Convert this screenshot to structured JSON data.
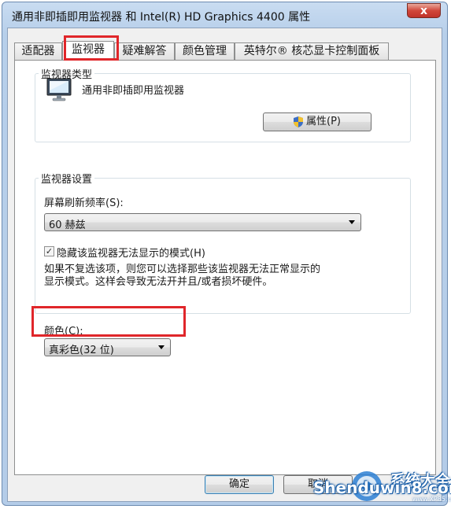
{
  "window": {
    "title": "通用非即插即用监视器 和 Intel(R) HD Graphics 4400 属性",
    "close_label": "x"
  },
  "tabs": [
    {
      "label": "适配器"
    },
    {
      "label": "监视器"
    },
    {
      "label": "疑难解答"
    },
    {
      "label": "颜色管理"
    },
    {
      "label": "英特尔® 核芯显卡控制面板"
    }
  ],
  "active_tab": "监视器",
  "monitor_type": {
    "group_title": "监视器类型",
    "monitor_name": "通用非即插即用监视器",
    "properties_button": "属性(P)"
  },
  "monitor_settings": {
    "group_title": "监视器设置",
    "refresh_label": "屏幕刷新频率(S):",
    "refresh_value": "60 赫兹",
    "hide_modes_checked": true,
    "hide_modes_label": "隐藏该监视器无法显示的模式(H)",
    "description_line1": "如果不复选该项，则您可以选择那些该监视器无法正常显示的",
    "description_line2": "显示模式。这样会导致无法开并且/或者损坏硬件。"
  },
  "colors": {
    "label": "颜色(C):",
    "value": "真彩色(32 位)"
  },
  "footer": {
    "ok_label": "确定",
    "cancel_label": "取消"
  },
  "watermark": {
    "site": "Shenduwin8.com",
    "brand_cn": "系统大全",
    "small": "www.XP85.com"
  },
  "highlight_color": "#e0262a"
}
